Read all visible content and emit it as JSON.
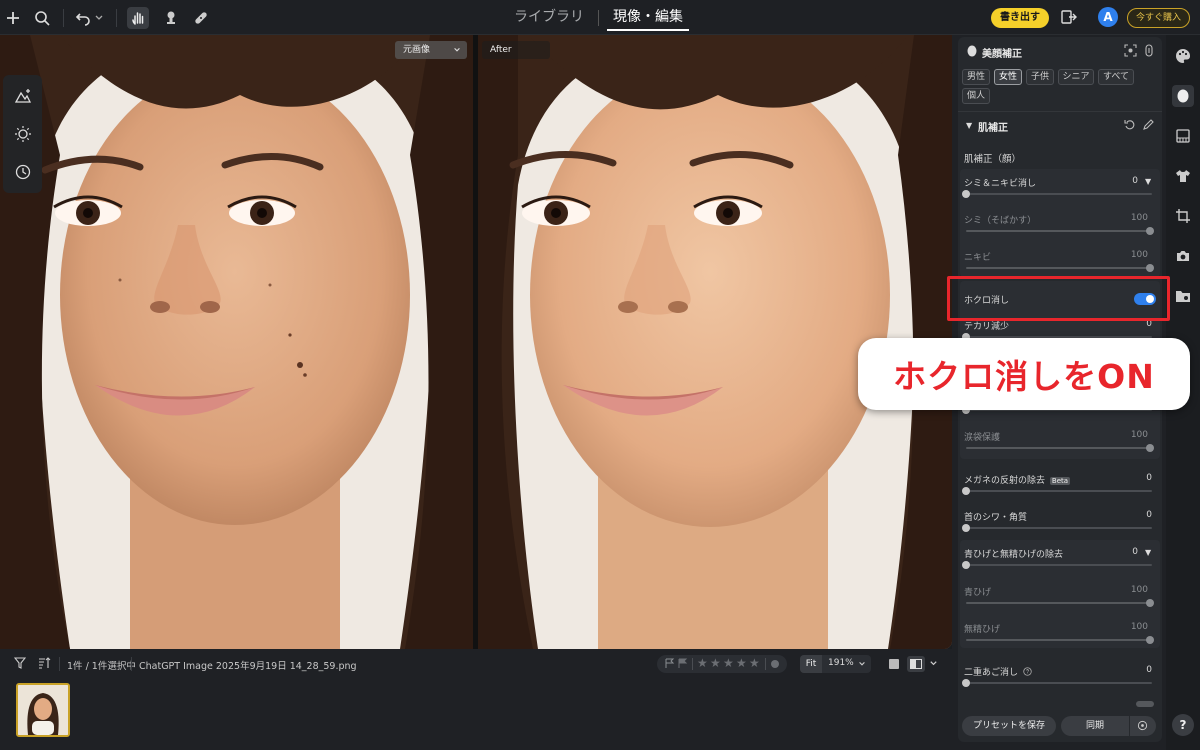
{
  "topbar": {
    "tabs": [
      {
        "label": "ライブラリ",
        "current": false
      },
      {
        "label": "現像・編集",
        "current": true
      }
    ],
    "export_label": "書き出す",
    "avatar_initial": "A",
    "buy_label": "今すぐ購入"
  },
  "viewer": {
    "before_label": "元画像",
    "after_label": "After"
  },
  "filmstrip": {
    "selection_text": "1件 / 1件選択中",
    "file_name": "ChatGPT Image 2025年9月19日 14_28_59.png",
    "fit_label": "Fit",
    "zoom_value": "191%"
  },
  "panel": {
    "section_title": "美顔補正",
    "chips": [
      "男性",
      "女性",
      "子供",
      "シニア",
      "すべて",
      "個人"
    ],
    "selected_chip": "女性",
    "sub_title": "肌補正",
    "sub_sub_title": "肌補正（顔）",
    "rows": {
      "blemish": {
        "label": "シミ＆ニキビ消し",
        "value": "0"
      },
      "spots": {
        "label": "シミ（そばかす）",
        "value": "100"
      },
      "acne": {
        "label": "ニキビ",
        "value": "100"
      },
      "mole": {
        "label": "ホクロ消し"
      },
      "shine": {
        "label": "テカリ減少",
        "value": "0"
      },
      "eyebag": {
        "label": "涙袋保護",
        "value": "100"
      },
      "glasses": {
        "label": "メガネの反射の除去",
        "badge": "Beta",
        "value": "0"
      },
      "neck": {
        "label": "首のシワ・角質",
        "value": "0"
      },
      "beard": {
        "label": "青ひげと無精ひげの除去",
        "value": "0"
      },
      "blue_beard": {
        "label": "青ひげ",
        "value": "100"
      },
      "stubble": {
        "label": "無精ひげ",
        "value": "100"
      },
      "double_chin": {
        "label": "二重あご消し",
        "value": "0"
      }
    },
    "preset_label": "プリセットを保存",
    "sync_label": "同期"
  },
  "callout": {
    "text": "ホクロ消しをON"
  },
  "help_label": "?"
}
